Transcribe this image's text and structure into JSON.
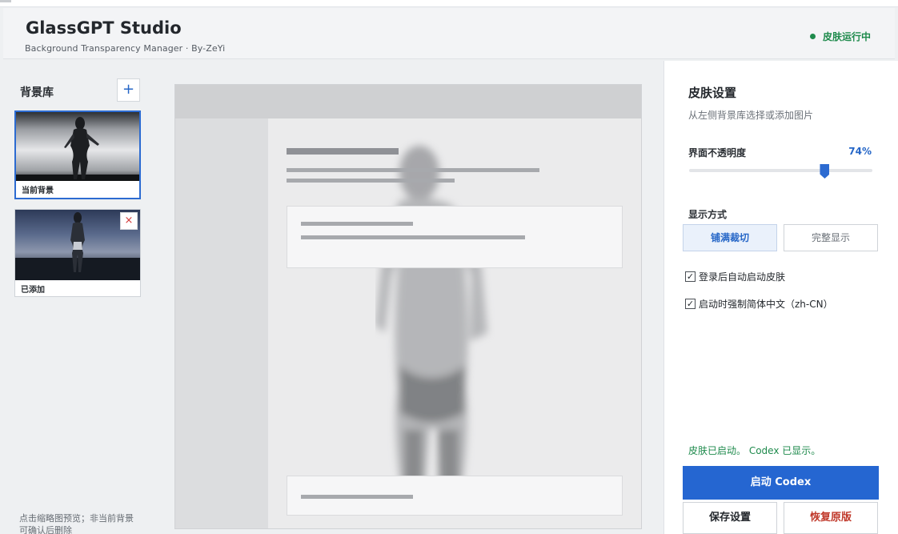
{
  "header": {
    "title": "GlassGPT Studio",
    "subtitle": "Background Transparency Manager · By-ZeYi",
    "status": "皮肤运行中"
  },
  "library": {
    "title": "背景库",
    "add_label": "+",
    "items": [
      {
        "caption": "当前背景",
        "active": true
      },
      {
        "caption": "已添加",
        "delete_label": "×"
      }
    ],
    "hint": "点击缩略图预览；非当前背景可确认后删除"
  },
  "settings": {
    "title": "皮肤设置",
    "subtitle": "从左侧背景库选择或添加图片",
    "opacity_label": "界面不透明度",
    "opacity_value": "74%",
    "opacity_fraction": 0.74,
    "mode_label": "显示方式",
    "modes": [
      "铺满裁切",
      "完整显示"
    ],
    "selected_mode": 0,
    "checks": [
      {
        "label": "登录后自动启动皮肤",
        "checked": true
      },
      {
        "label": "启动时强制简体中文（zh-CN）",
        "checked": true
      }
    ],
    "status_message": "皮肤已启动。 Codex 已显示。",
    "launch_label": "启动 Codex",
    "save_label": "保存设置",
    "restore_label": "恢复原版"
  },
  "colors": {
    "accent": "#2566d1",
    "success": "#1e8a4c",
    "danger": "#c0392b"
  }
}
